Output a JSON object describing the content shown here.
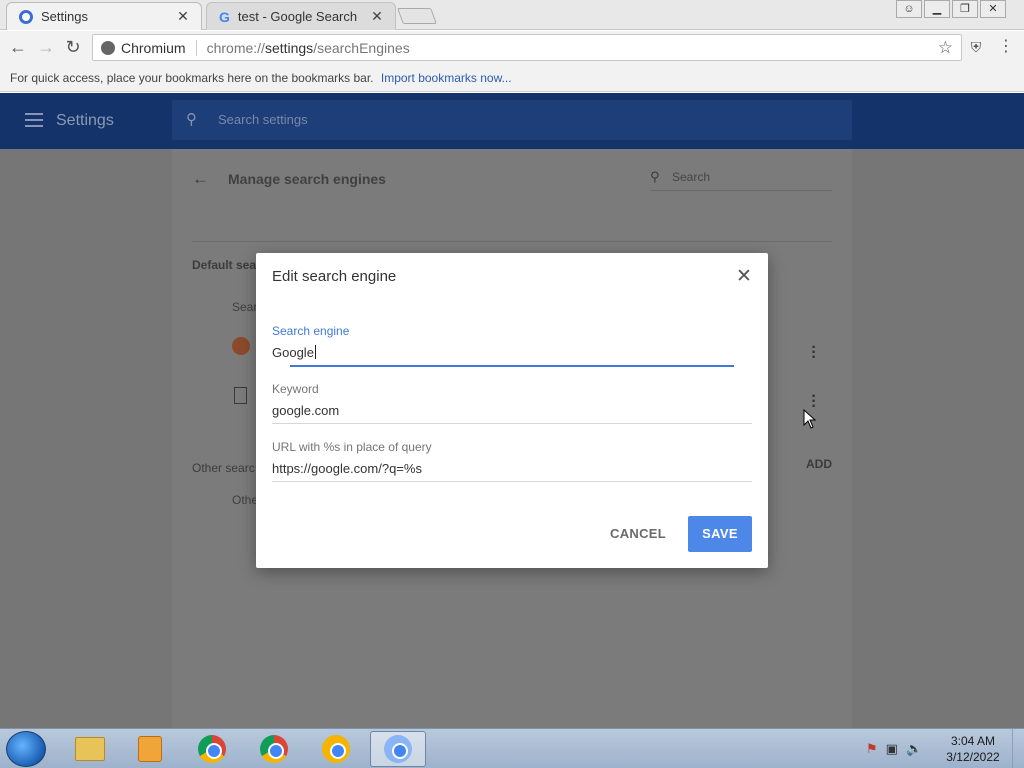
{
  "browser": {
    "tabs": [
      {
        "label": "Settings",
        "active": true
      },
      {
        "label": "test - Google Search",
        "active": false
      }
    ],
    "close_glyph": "✕",
    "window_controls": [
      "person-icon",
      "minimize-icon",
      "restore-icon",
      "close-icon"
    ],
    "address": {
      "origin": "Chromium",
      "url_prefix": "chrome://",
      "url_host": "settings",
      "url_path": "/searchEngines"
    },
    "bookmarks_bar": {
      "hint": "For quick access, place your bookmarks here on the bookmarks bar.",
      "import_link": "Import bookmarks now..."
    }
  },
  "settings": {
    "title": "Settings",
    "search_placeholder": "Search settings",
    "page_heading": "Manage search engines",
    "page_search_placeholder": "Search",
    "default_section": "Default sear",
    "default_subheader": "Sear",
    "other_section": "Other searc",
    "other_subheader": "Othe",
    "add_label": "ADD"
  },
  "dialog": {
    "title": "Edit search engine",
    "fields": [
      {
        "label": "Search engine",
        "value": "Google",
        "focused": true
      },
      {
        "label": "Keyword",
        "value": "google.com",
        "focused": false
      },
      {
        "label": "URL with %s in place of query",
        "value": "https://google.com/?q=%s",
        "focused": false
      }
    ],
    "cancel_label": "CANCEL",
    "save_label": "SAVE",
    "accent_color": "#4d88e8"
  },
  "taskbar": {
    "apps": [
      "windows-explorer-icon",
      "media-player-icon",
      "chrome-icon",
      "chrome-beta-icon",
      "chrome-canary-icon",
      "chromium-icon"
    ],
    "time": "3:04 AM",
    "date": "3/12/2022"
  }
}
